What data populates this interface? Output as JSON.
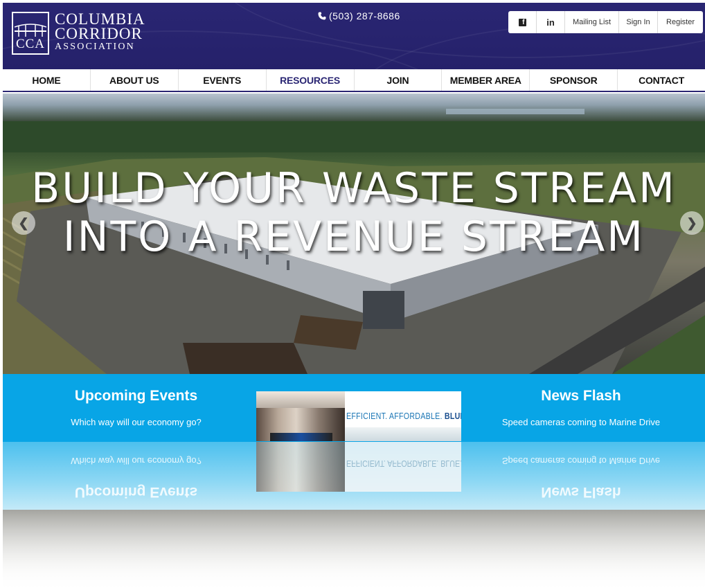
{
  "header": {
    "logo": {
      "mark_text": "CCA",
      "line1": "COLUMBIA",
      "line2": "CORRIDOR",
      "line3": "ASSOCIATION"
    },
    "phone": "(503) 287-8686",
    "top_links": {
      "facebook_icon": "facebook-icon",
      "linkedin_icon": "linkedin-icon",
      "mailing_list": "Mailing List",
      "sign_in": "Sign In",
      "register": "Register"
    }
  },
  "nav": {
    "items": [
      {
        "label": "HOME"
      },
      {
        "label": "ABOUT US"
      },
      {
        "label": "EVENTS"
      },
      {
        "label": "RESOURCES"
      },
      {
        "label": "JOIN"
      },
      {
        "label": "MEMBER AREA"
      },
      {
        "label": "SPONSOR"
      },
      {
        "label": "CONTACT"
      }
    ],
    "active": "RESOURCES"
  },
  "hero": {
    "title_line1": "BUILD YOUR WASTE STREAM",
    "title_line2": "INTO A REVENUE STREAM",
    "prev_icon": "chevron-left-icon",
    "next_icon": "chevron-right-icon"
  },
  "band": {
    "events": {
      "title": "Upcoming Events",
      "subtitle": "Which way will our economy go?"
    },
    "ad": {
      "tagline": "EFFICIENT. AFFORDABLE.",
      "tagline_bold": "BLUE."
    },
    "news": {
      "title": "News Flash",
      "subtitle": "Speed cameras coming to Marine Drive"
    }
  },
  "colors": {
    "header_bg": "#2a2673",
    "band_bg": "#08a5e6",
    "nav_active": "#2a2673"
  }
}
